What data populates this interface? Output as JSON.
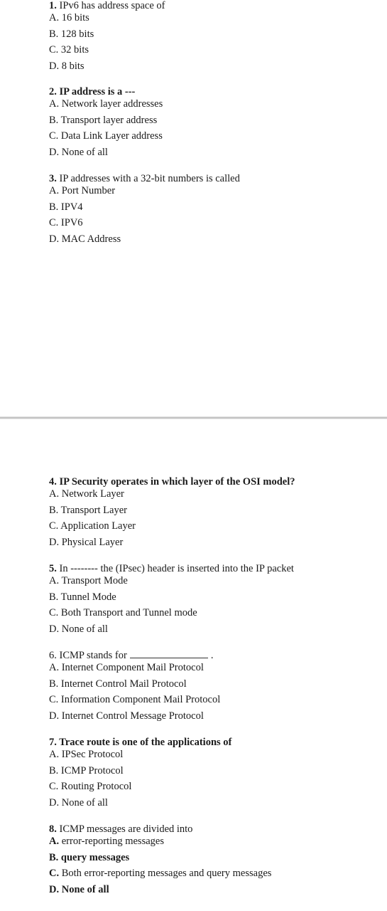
{
  "questions": [
    {
      "number": "1.",
      "text": "IPv6 has address space of",
      "options": [
        "A. 16 bits",
        "B. 128 bits",
        "C. 32 bits",
        "D. 8 bits"
      ]
    },
    {
      "number": "2.",
      "text": "IP address is a ---",
      "options": [
        "A. Network layer addresses",
        "B. Transport layer address",
        "C. Data Link Layer address",
        "D. None of all"
      ]
    },
    {
      "number": "3.",
      "text": "IP addresses with a 32-bit numbers is called",
      "options": [
        "A. Port Number",
        "B. IPV4",
        "C. IPV6",
        "D. MAC Address"
      ]
    },
    {
      "number": "4.",
      "text": "IP Security operates in which layer of the OSI model?",
      "options": [
        "A. Network Layer",
        "B. Transport Layer",
        "C. Application Layer",
        "D. Physical Layer"
      ]
    },
    {
      "number": "5.",
      "text": "In -------- the (IPsec) header is inserted into the IP packet",
      "options": [
        "A. Transport Mode",
        "B. Tunnel Mode",
        "C. Both Transport and Tunnel mode",
        "D. None of all"
      ]
    },
    {
      "number": "6.",
      "text": "ICMP stands for",
      "text_suffix": ".",
      "options": [
        "A. Internet Component Mail Protocol",
        "B. Internet Control Mail Protocol",
        "C. Information Component Mail Protocol",
        "D. Internet Control Message Protocol"
      ]
    },
    {
      "number": "7.",
      "text": "Trace route is one of the applications of",
      "options": [
        "A. IPSec Protocol",
        "B. ICMP Protocol",
        "C. Routing Protocol",
        "D. None of all"
      ]
    },
    {
      "number": "8.",
      "text": "ICMP messages are divided into",
      "options": [
        {
          "letter": "A.",
          "text": "error-reporting messages"
        },
        {
          "letter": "B.",
          "text": "query messages"
        },
        {
          "letter": "C.",
          "text": "Both error-reporting messages and query messages"
        },
        {
          "letter": "D.",
          "text": "None of all"
        }
      ]
    }
  ]
}
